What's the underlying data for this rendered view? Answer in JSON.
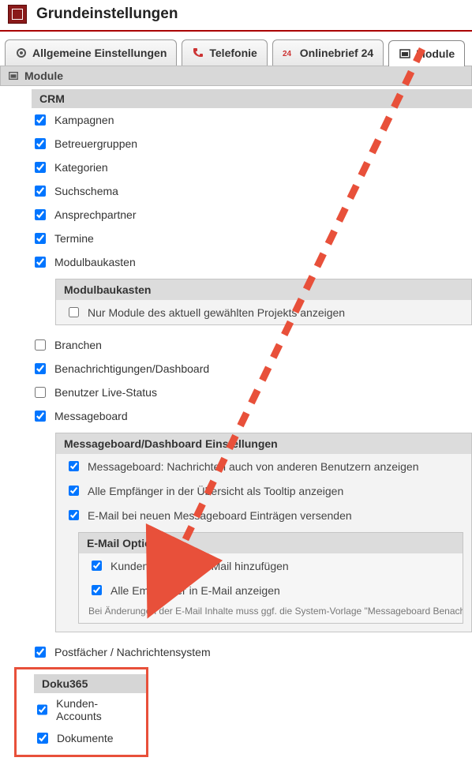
{
  "header": {
    "title": "Grundeinstellungen"
  },
  "tabs": {
    "general": "Allgemeine Einstellungen",
    "telefonie": "Telefonie",
    "onlinebrief": "Onlinebrief 24",
    "module": "Module"
  },
  "panel_label": "Module",
  "crm": {
    "title": "CRM",
    "items": [
      {
        "label": "Kampagnen",
        "checked": true
      },
      {
        "label": "Betreuergruppen",
        "checked": true
      },
      {
        "label": "Kategorien",
        "checked": true
      },
      {
        "label": "Suchschema",
        "checked": true
      },
      {
        "label": "Ansprechpartner",
        "checked": true
      },
      {
        "label": "Termine",
        "checked": true
      },
      {
        "label": "Modulbaukasten",
        "checked": true
      }
    ],
    "modulbaukasten_box": {
      "title": "Modulbaukasten",
      "option": {
        "label": "Nur Module des aktuell gewählten Projekts anzeigen",
        "checked": false
      }
    },
    "items2": [
      {
        "label": "Branchen",
        "checked": false
      },
      {
        "label": "Benachrichtigungen/Dashboard",
        "checked": true
      },
      {
        "label": "Benutzer Live-Status",
        "checked": false
      },
      {
        "label": "Messageboard",
        "checked": true
      }
    ],
    "messageboard_box": {
      "title": "Messageboard/Dashboard Einstellungen",
      "options": [
        {
          "label": "Messageboard: Nachrichten auch von anderen Benutzern anzeigen",
          "checked": true
        },
        {
          "label": "Alle Empfänger in der Übersicht als Tooltip anzeigen",
          "checked": true
        },
        {
          "label": "E-Mail bei neuen Messageboard Einträgen versenden",
          "checked": true
        }
      ],
      "email_box": {
        "title": "E-Mail Optionen",
        "options": [
          {
            "label": "Kunden-Report in E-Mail hinzufügen",
            "checked": true
          },
          {
            "label": "Alle Empfänger in E-Mail anzeigen",
            "checked": true
          }
        ],
        "note": "Bei Änderungen der E-Mail Inhalte muss ggf. die System-Vorlage \"Messageboard Benachrichtigung\" na"
      }
    },
    "items3": [
      {
        "label": "Postfächer / Nachrichtensystem",
        "checked": true
      }
    ]
  },
  "doku365": {
    "title": "Doku365",
    "items": [
      {
        "label": "Kunden-Accounts",
        "checked": true
      },
      {
        "label": "Dokumente",
        "checked": true
      }
    ]
  }
}
